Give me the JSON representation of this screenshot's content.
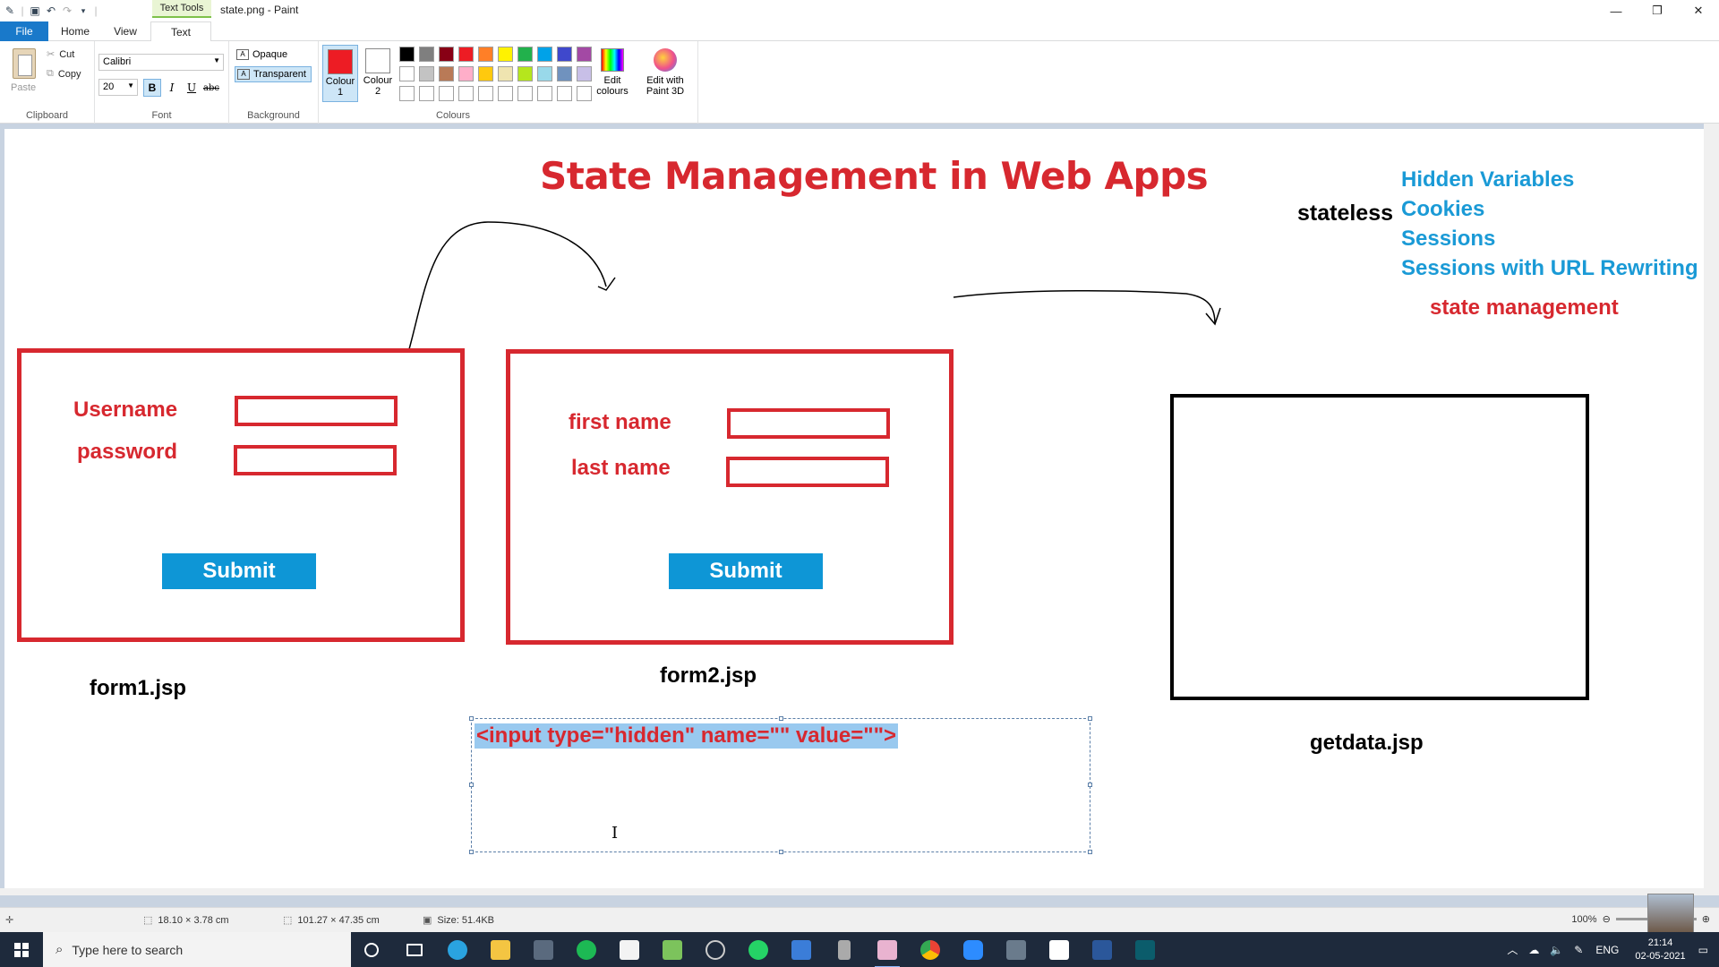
{
  "window": {
    "title": "state.png - Paint",
    "context_tab": "Text Tools"
  },
  "tabs": {
    "file": "File",
    "home": "Home",
    "view": "View",
    "text": "Text"
  },
  "ribbon": {
    "clipboard": {
      "label": "Clipboard",
      "paste": "Paste",
      "cut": "Cut",
      "copy": "Copy"
    },
    "font": {
      "label": "Font",
      "family": "Calibri",
      "size": "20",
      "bold": "B",
      "italic": "I",
      "underline": "U",
      "strike": "abc"
    },
    "background": {
      "label": "Background",
      "opaque": "Opaque",
      "transparent": "Transparent"
    },
    "colours": {
      "label": "Colours",
      "colour1": "Colour 1",
      "colour2": "Colour 2",
      "colour1_value": "#ed1c24",
      "colour2_value": "#ffffff",
      "edit": "Edit colours",
      "paint3d": "Edit with Paint 3D",
      "palette_row1": [
        "#000000",
        "#7f7f7f",
        "#880015",
        "#ed1c24",
        "#ff7f27",
        "#fff200",
        "#22b14c",
        "#00a2e8",
        "#3f48cc",
        "#a349a4"
      ],
      "palette_row2": [
        "#ffffff",
        "#c3c3c3",
        "#b97a57",
        "#ffaec9",
        "#ffc90e",
        "#efe4b0",
        "#b5e61d",
        "#99d9ea",
        "#7092be",
        "#c8bfe7"
      ],
      "palette_row3": [
        "#ffffff",
        "#ffffff",
        "#ffffff",
        "#ffffff",
        "#ffffff",
        "#ffffff",
        "#ffffff",
        "#ffffff",
        "#ffffff",
        "#ffffff"
      ]
    }
  },
  "canvas": {
    "title": "State Management in Web Apps",
    "stateless": "stateless",
    "techniques": [
      "Hidden Variables",
      "Cookies",
      "Sessions",
      "Sessions with URL Rewriting"
    ],
    "state_management": "state management",
    "form1": {
      "username": "Username",
      "password": "password",
      "submit": "Submit",
      "caption": "form1.jsp"
    },
    "form2": {
      "first_name": "first name",
      "last_name": "last name",
      "submit": "Submit",
      "caption": "form2.jsp"
    },
    "getdata": {
      "caption": "getdata.jsp"
    },
    "text_box": "<input type=\"hidden\" name=\"\" value=\"\">"
  },
  "status": {
    "selection": "18.10 × 3.78 cm",
    "image_size": "101.27 × 47.35 cm",
    "file_size": "Size: 51.4KB",
    "zoom": "100%"
  },
  "taskbar": {
    "search_placeholder": "Type here to search",
    "lang": "ENG",
    "time": "21:14",
    "date": "02-05-2021"
  }
}
